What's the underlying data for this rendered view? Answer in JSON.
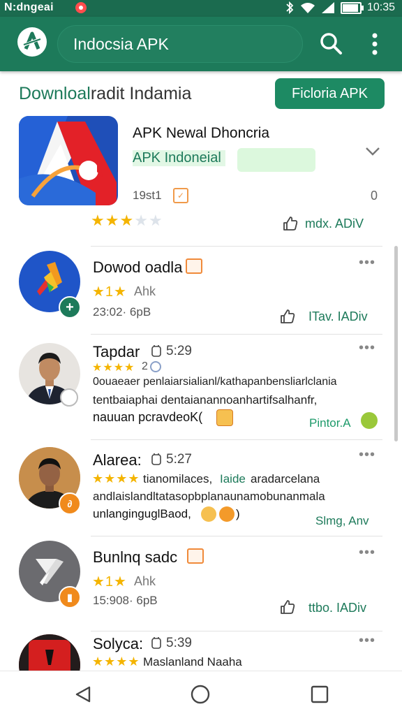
{
  "status_bar": {
    "carrier": "N:dngeai",
    "time": "10:35",
    "battery_level": 0.85
  },
  "app_bar": {
    "search_value": "Indocsia APK"
  },
  "section": {
    "title_part1": "Downloal",
    "title_part2": "radit Indamia",
    "action_button": "Ficloria APK"
  },
  "featured": {
    "app_name": "APK Newal Dhoncria",
    "tag": "APK Indoneial",
    "meta": "19st1",
    "count": "0",
    "rating": 3,
    "action_label": "mdx. ADiV"
  },
  "items": [
    {
      "type": "app",
      "name": "Dowod oadla",
      "stars_text": "★1★",
      "rating_extra": "Ahk",
      "meta": "23:02· 6pB",
      "action_label": "ITav. IADiv"
    },
    {
      "type": "review",
      "name": "Tapdar",
      "time": "5:29",
      "stars_text": "★★★★",
      "rating_num": "2",
      "text_line1": "0ouaeaer penlaiarsialianl/kathapanbensliarlclania",
      "text_line2": "tentbaiaphai dentaianannoanhartifsalhanfr,",
      "text_line3": "nauuan pcravdeoK(",
      "action_label": "Pintor.A"
    },
    {
      "type": "review",
      "name": "Alarea:",
      "time": "5:27",
      "stars_text": "★★★★",
      "text_line1_a": "tianomilaces,",
      "text_line1_b": "Iaide",
      "text_line1_c": "aradarcelana",
      "text_line2": "andlaislandltatasopbplanaunamobunanmala",
      "text_line3": "unlanginguglBaod,",
      "action_label": "Slmg, Anv"
    },
    {
      "type": "app",
      "name": "Bunlnq sadc",
      "stars_text": "★1★",
      "rating_extra": "Ahk",
      "meta": "15:908· 6pB",
      "action_label": "ttbo. IADiv"
    },
    {
      "type": "review",
      "name": "Solyca:",
      "time": "5:39",
      "stars_text": "★★★★",
      "text_line1": "Maslanland Naaha"
    }
  ]
}
